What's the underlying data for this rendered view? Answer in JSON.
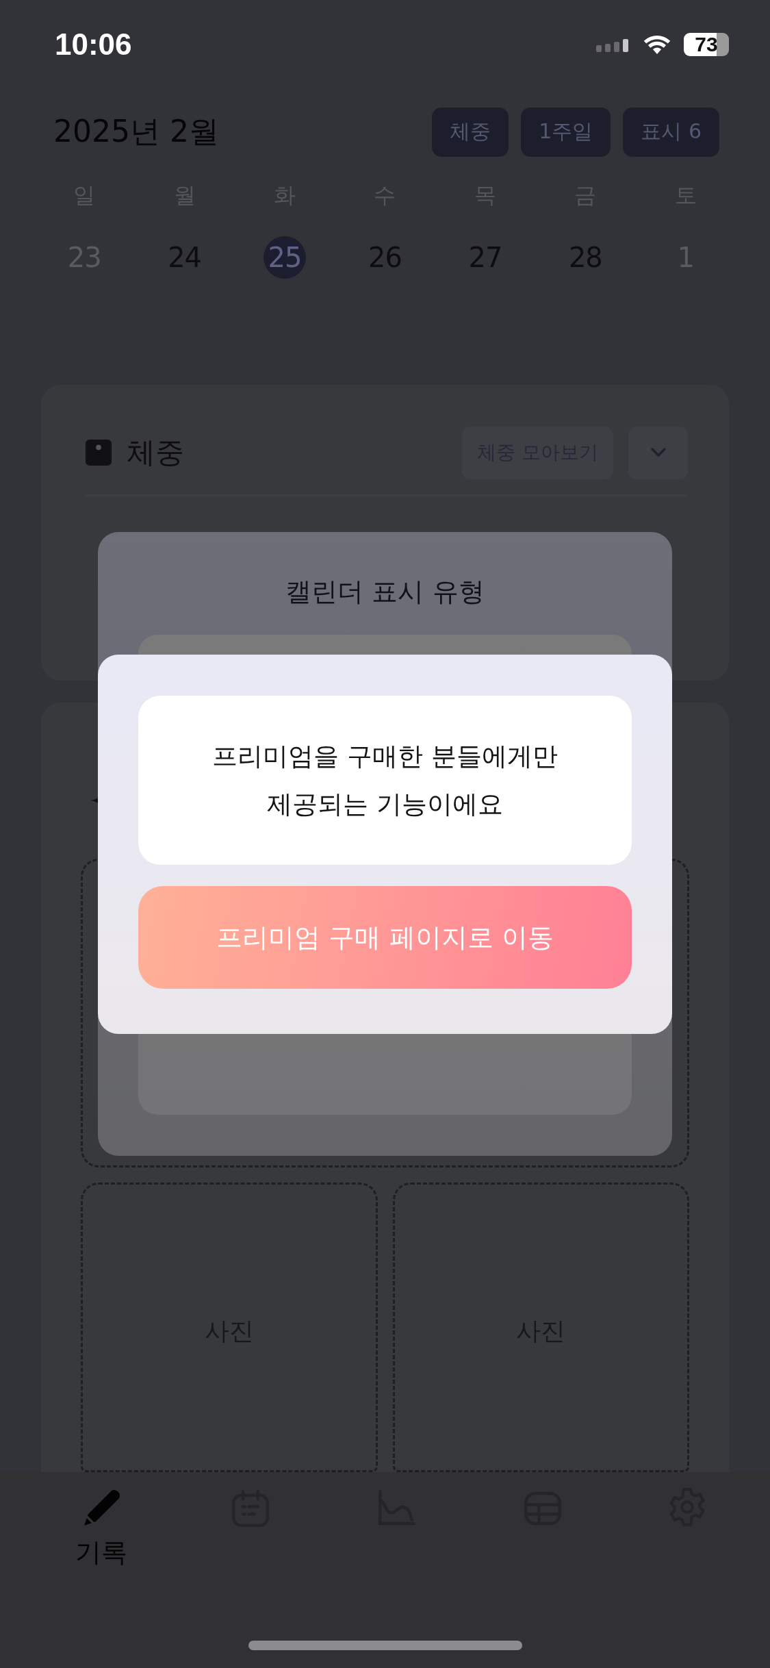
{
  "status_bar": {
    "time": "10:06",
    "battery": "73"
  },
  "header": {
    "title": "2025년 2월",
    "buttons": [
      {
        "label": "체중"
      },
      {
        "label": "1주일"
      },
      {
        "label": "표시 6"
      }
    ]
  },
  "week": {
    "weekdays": [
      "일",
      "월",
      "화",
      "수",
      "목",
      "금",
      "토"
    ],
    "dates": [
      {
        "label": "23",
        "selected": false,
        "dimmed": true
      },
      {
        "label": "24",
        "selected": false,
        "dimmed": false
      },
      {
        "label": "25",
        "selected": true,
        "dimmed": false
      },
      {
        "label": "26",
        "selected": false,
        "dimmed": false
      },
      {
        "label": "27",
        "selected": false,
        "dimmed": false
      },
      {
        "label": "28",
        "selected": false,
        "dimmed": false
      },
      {
        "label": "1",
        "selected": false,
        "dimmed": true
      }
    ]
  },
  "weight_card": {
    "title": "체중",
    "summary_button": "체중 모아보기"
  },
  "photo_card": {
    "slots": [
      {
        "label": "사진"
      },
      {
        "label": "사진"
      }
    ]
  },
  "tab_bar": {
    "items": [
      {
        "kind": "pencil",
        "label": "기록",
        "selected": true
      },
      {
        "kind": "calendar",
        "selected": false
      },
      {
        "kind": "chart",
        "selected": false
      },
      {
        "kind": "table",
        "selected": false
      },
      {
        "kind": "gear",
        "selected": false
      }
    ]
  },
  "sheet": {
    "title": "캘린더 표시 유형"
  },
  "premium_dialog": {
    "message": "프리미엄을 구매한 분들에게만\n제공되는 기능이에요",
    "button": "프리미엄 구매 페이지로 이동"
  }
}
